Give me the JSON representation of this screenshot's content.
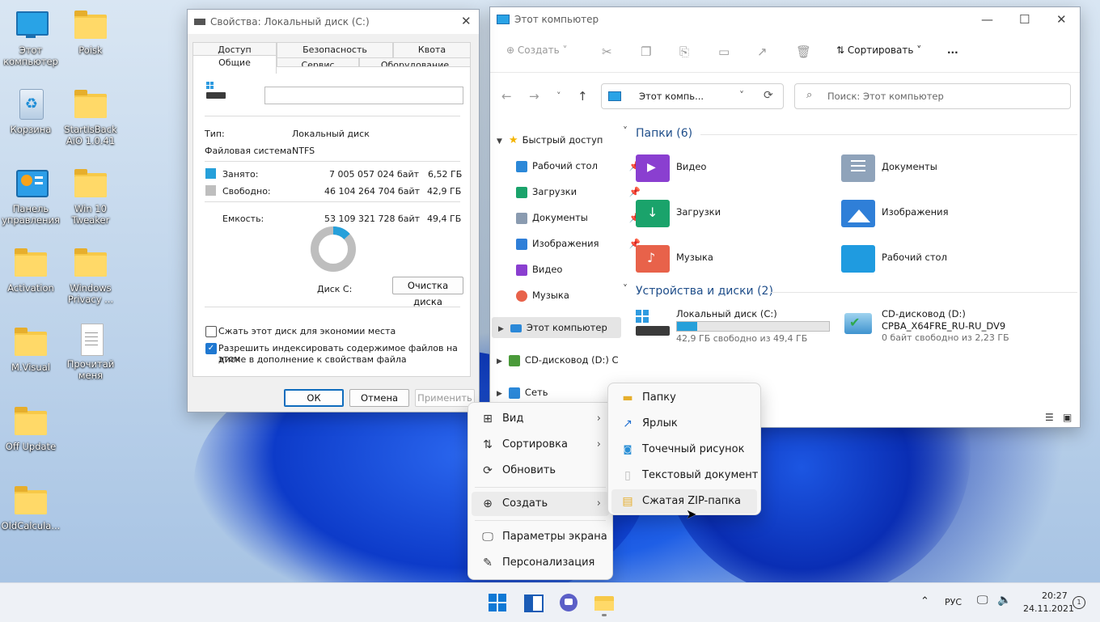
{
  "desktop": {
    "icons": [
      {
        "label": "Этот компьютер",
        "icon": "computer-icon"
      },
      {
        "label": "Poisk",
        "icon": "folder-icon"
      },
      {
        "label": "Корзина",
        "icon": "recycle-bin-icon"
      },
      {
        "label": "StartIsBack AiO 1.0.41",
        "icon": "folder-icon"
      },
      {
        "label": "Панель управления",
        "icon": "control-panel-icon"
      },
      {
        "label": "Win 10 Tweaker",
        "icon": "folder-icon"
      },
      {
        "label": "Activation",
        "icon": "folder-icon"
      },
      {
        "label": "Windows Privacy ...",
        "icon": "folder-icon"
      },
      {
        "label": "M.Visual",
        "icon": "folder-icon"
      },
      {
        "label": "Прочитай меня",
        "icon": "text-file-icon"
      },
      {
        "label": "Off Update",
        "icon": "folder-icon"
      },
      {
        "label": "OldCalcula...",
        "icon": "folder-icon"
      }
    ]
  },
  "properties": {
    "title": "Свойства: Локальный диск (C:)",
    "tabs_row1": [
      "Доступ",
      "Безопасность",
      "Квота"
    ],
    "tabs_row2": [
      "Общие",
      "Сервис",
      "Оборудование"
    ],
    "type_label": "Тип:",
    "type_value": "Локальный диск",
    "fs_label": "Файловая система:",
    "fs_value": "NTFS",
    "used_label": "Занято:",
    "used_bytes": "7 005 057 024 байт",
    "used_gb": "6,52 ГБ",
    "free_label": "Свободно:",
    "free_bytes": "46 104 264 704 байт",
    "free_gb": "42,9 ГБ",
    "cap_label": "Емкость:",
    "cap_bytes": "53 109 321 728 байт",
    "cap_gb": "49,4 ГБ",
    "used_fraction": 0.132,
    "disk_label": "Диск C:",
    "cleanup_button": "Очистка диска",
    "compress_label": "Сжать этот диск для экономии места",
    "compress_checked": false,
    "index_label_1": "Разрешить индексировать содержимое файлов на этом",
    "index_label_2": "диске в дополнение к свойствам файла",
    "index_checked": true,
    "ok": "ОК",
    "cancel": "Отмена",
    "apply": "Применить",
    "colors": {
      "used": "#26a0da",
      "free": "#bebebe"
    }
  },
  "explorer": {
    "title": "Этот компьютер",
    "toolbar": {
      "create": "Создать",
      "sort": "Сортировать",
      "more": "..."
    },
    "address": "Этот компь...",
    "search_placeholder": "Поиск: Этот компьютер",
    "nav": [
      {
        "label": "Быстрый доступ",
        "color": "#f4b400"
      },
      {
        "label": "Рабочий стол",
        "color": "#2b88d8"
      },
      {
        "label": "Загрузки",
        "color": "#1aa36b"
      },
      {
        "label": "Документы",
        "color": "#8a9bb0"
      },
      {
        "label": "Изображения",
        "color": "#2f7fd8"
      },
      {
        "label": "Видео",
        "color": "#8a3fd0"
      },
      {
        "label": "Музыка",
        "color": "#e8624a"
      },
      {
        "label": "Этот компьютер",
        "color": "#2b88d8"
      },
      {
        "label": "CD-дисковод (D:) C",
        "color": "#4a9a3a"
      },
      {
        "label": "Сеть",
        "color": "#2b88d8"
      }
    ],
    "folders_header": "Папки (6)",
    "folders": [
      {
        "label": "Видео",
        "color": "#8a3fd0"
      },
      {
        "label": "Документы",
        "color": "#8fa3ba"
      },
      {
        "label": "Загрузки",
        "color": "#1aa36b"
      },
      {
        "label": "Изображения",
        "color": "#2f7fd8"
      },
      {
        "label": "Музыка",
        "color": "#e8624a"
      },
      {
        "label": "Рабочий стол",
        "color": "#1f9be0"
      }
    ],
    "drives_header": "Устройства и диски (2)",
    "drive_c": {
      "name": "Локальный диск (C:)",
      "free": "42,9 ГБ свободно из 49,4 ГБ",
      "used_fraction": 0.132
    },
    "drive_d": {
      "name": "CD-дисковод (D:)",
      "label": "CPBA_X64FRE_RU-RU_DV9",
      "free": "0 байт свободно из 2,23 ГБ"
    }
  },
  "context_menu": {
    "items": [
      "Вид",
      "Сортировка",
      "Обновить",
      "Создать",
      "Параметры экрана",
      "Персонализация"
    ]
  },
  "submenu": {
    "items": [
      "Папку",
      "Ярлык",
      "Точечный рисунок",
      "Текстовый документ",
      "Сжатая ZIP-папка"
    ]
  },
  "taskbar": {
    "lang": "РУС",
    "time": "20:27",
    "date": "24.11.2021"
  }
}
